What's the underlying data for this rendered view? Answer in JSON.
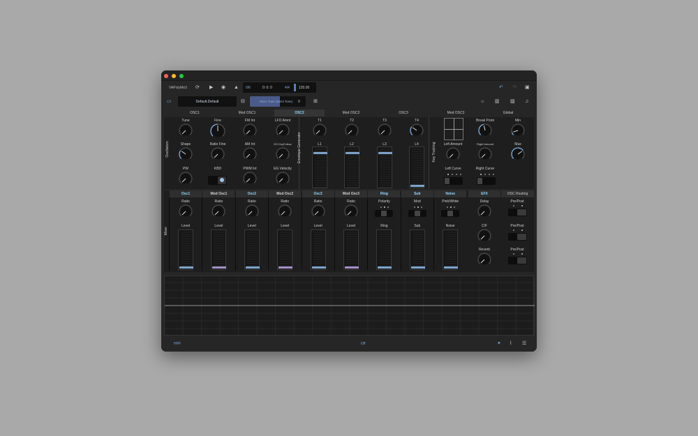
{
  "window": {
    "title": "VAPolyMe3",
    "traffic_colors": [
      "#fe5f57",
      "#febc2e",
      "#28c840"
    ]
  },
  "transport": {
    "bar_count": "0/6",
    "position": "0: 0: 0",
    "time_signature": "4/4",
    "tempo": "120.00"
  },
  "preset": {
    "name": "Default.Default",
    "param_label": "Osc1 Tune (Semi Tone)",
    "param_value": "0"
  },
  "tabs": [
    "OSC1",
    "Mod OSC1",
    "OSC2",
    "Mod OSC2",
    "OSC3",
    "Mod OSC3",
    "Global"
  ],
  "active_tab": "OSC2",
  "oscillators": {
    "section_label": "Oscillators",
    "knobs": [
      "Tune",
      "Fine",
      "FM Int",
      "LFO Amnt",
      "Shape",
      "Ratio Fine",
      "AM Int",
      "EG KeyFollow",
      "PW",
      "PWM Int",
      "EG Velocity"
    ],
    "kbd_label": "KBD"
  },
  "envelope": {
    "section_label": "Envelope Generator",
    "time_knobs": [
      "T1",
      "T2",
      "T3",
      "T4"
    ],
    "levels": [
      {
        "label": "L1",
        "value": 0.9
      },
      {
        "label": "L2",
        "value": 0.9
      },
      {
        "label": "L3",
        "value": 0.9
      },
      {
        "label": "L4",
        "value": 0.03
      }
    ]
  },
  "key_tracking": {
    "section_label": "Key Tracking",
    "labels": [
      "Break Point",
      "Min",
      "Left Amount",
      "Right Amount",
      "Max",
      "Left Curve",
      "Right Curve"
    ]
  },
  "mixer": {
    "section_label": "Mixer",
    "channels": [
      {
        "name": "Osc1",
        "top": "Ratio",
        "bottom": "Level",
        "color": "#7fa7ce",
        "highlight": true
      },
      {
        "name": "Mod Osc1",
        "top": "Ratio",
        "bottom": "Level",
        "color": "#a593c8",
        "highlight": false
      },
      {
        "name": "Osc2",
        "top": "Ratio",
        "bottom": "Level",
        "color": "#7fa7ce",
        "highlight": true
      },
      {
        "name": "Mod Osc2",
        "top": "Ratio",
        "bottom": "Level",
        "color": "#a593c8",
        "highlight": false
      },
      {
        "name": "Osc3",
        "top": "Ratio",
        "bottom": "Level",
        "color": "#7fa7ce",
        "highlight": true
      },
      {
        "name": "Mod Osc3",
        "top": "Ratio",
        "bottom": "Level",
        "color": "#a593c8",
        "highlight": false
      },
      {
        "name": "Ring",
        "top": "Polarity",
        "bottom": "Ring",
        "color": "#7fa7ce",
        "highlight": true
      },
      {
        "name": "Sub",
        "top": "Mod",
        "bottom": "Sub",
        "color": "#7fa7ce",
        "highlight": true
      },
      {
        "name": "Noise",
        "top": "Pink/White",
        "bottom": "Noise",
        "color": "#7fa7ce",
        "highlight": true
      }
    ],
    "efx": {
      "name": "EFX",
      "knobs": [
        "Delay",
        "C/F",
        "Reverb"
      ]
    },
    "routing": {
      "name": "OSC Routing",
      "prepost_label": "Pre/Post"
    }
  },
  "footer": {
    "filter": "HPF",
    "status": "Off"
  },
  "icons": [
    "loop-icon",
    "play-icon",
    "record-icon",
    "metronome-icon",
    "undo-icon",
    "redo-icon",
    "sidebar-icon",
    "folder-icon",
    "minus-icon",
    "plus-icon",
    "sun-icon",
    "keyboard-icon",
    "image-icon",
    "tuner-icon",
    "star-icon",
    "chart-icon",
    "menu-icon"
  ],
  "colors": {
    "accent": "#79a7d9",
    "purple": "#a593c8",
    "active_tab_text": "#8fd9ff"
  }
}
